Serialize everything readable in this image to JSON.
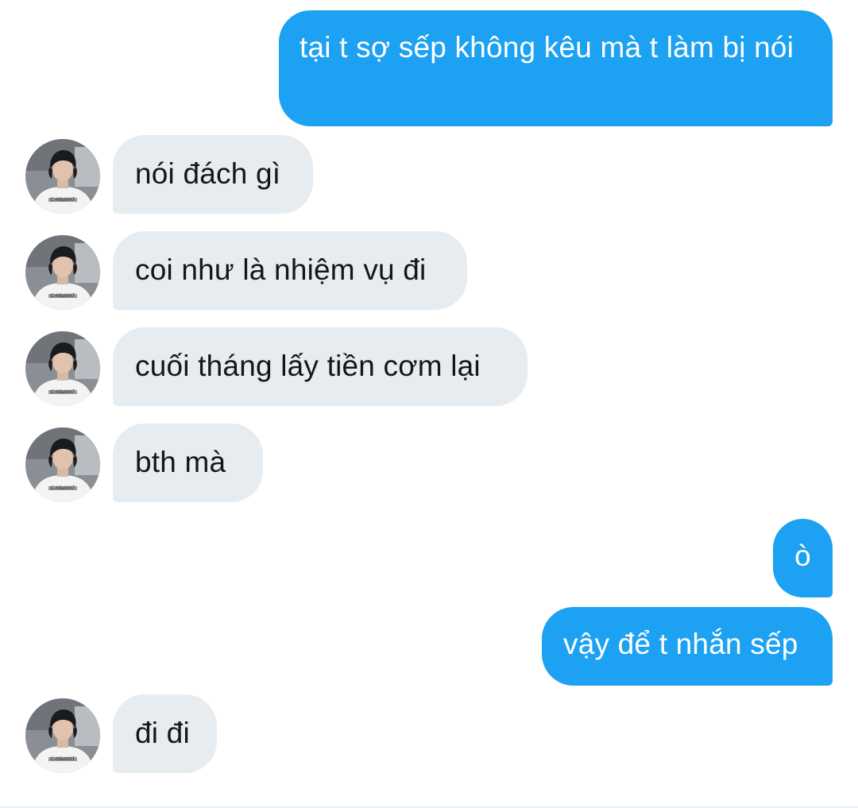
{
  "conversation": {
    "messages": [
      {
        "side": "sent",
        "text": "tại t sợ sếp không kêu mà t làm bị nói"
      },
      {
        "side": "received",
        "text": "nói đách gì"
      },
      {
        "side": "received",
        "text": "coi như là nhiệm vụ đi"
      },
      {
        "side": "received",
        "text": "cuối tháng lấy tiền cơm lại"
      },
      {
        "side": "received",
        "text": "bth mà"
      },
      {
        "side": "sent",
        "text": "ò"
      },
      {
        "side": "sent",
        "text": "vậy để t nhắn sếp"
      },
      {
        "side": "received",
        "text": "đi đi"
      }
    ],
    "avatar_shirt_text": "C-MãaWAT"
  },
  "colors": {
    "sent_bubble": "#1da1f2",
    "received_bubble": "#e6ecf0",
    "sent_text": "#ffffff",
    "received_text": "#14171a"
  }
}
